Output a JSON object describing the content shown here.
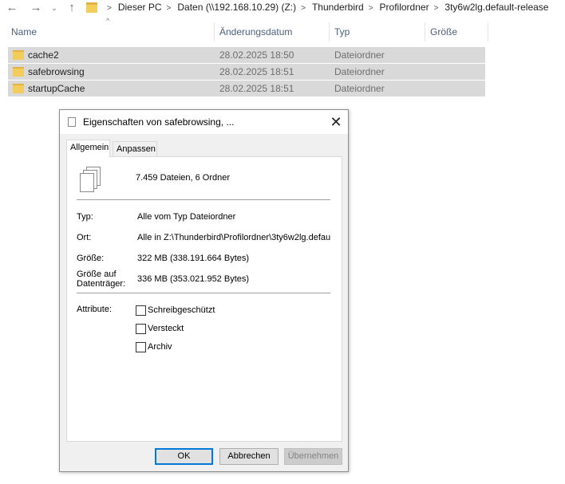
{
  "addressbar": {
    "nav": {
      "back": "←",
      "forward": "→",
      "recent": "⌄",
      "up": "↑"
    },
    "breadcrumbs": [
      "Dieser PC",
      "Daten (\\\\192.168.10.29) (Z:)",
      "Thunderbird",
      "Profilordner",
      "3ty6w2lg.default-release"
    ]
  },
  "columns": {
    "name": "Name",
    "date": "Änderungsdatum",
    "type": "Typ",
    "size": "Größe"
  },
  "files": [
    {
      "name": "cache2",
      "date": "28.02.2025 18:50",
      "type": "Dateiordner"
    },
    {
      "name": "safebrowsing",
      "date": "28.02.2025 18:51",
      "type": "Dateiordner"
    },
    {
      "name": "startupCache",
      "date": "28.02.2025 18:51",
      "type": "Dateiordner"
    }
  ],
  "dialog": {
    "title": "Eigenschaften von safebrowsing, ...",
    "close": "✕",
    "tabs": {
      "general": "Allgemein",
      "customize": "Anpassen"
    },
    "summary": "7.459 Dateien, 6 Ordner",
    "props": {
      "type_label": "Typ:",
      "type_value": "Alle vom Typ Dateiordner",
      "location_label": "Ort:",
      "location_value": "Alle in Z:\\Thunderbird\\Profilordner\\3ty6w2lg.defau",
      "size_label": "Größe:",
      "size_value": "322 MB (338.191.664 Bytes)",
      "disk_label_1": "Größe auf",
      "disk_label_2": "Datenträger:",
      "disk_value": "336 MB (353.021.952 Bytes)"
    },
    "attributes": {
      "label": "Attribute:",
      "readonly": "Schreibgeschützt",
      "hidden": "Versteckt",
      "archive": "Archiv"
    },
    "buttons": {
      "ok": "OK",
      "cancel": "Abbrechen",
      "apply": "Übernehmen"
    }
  }
}
